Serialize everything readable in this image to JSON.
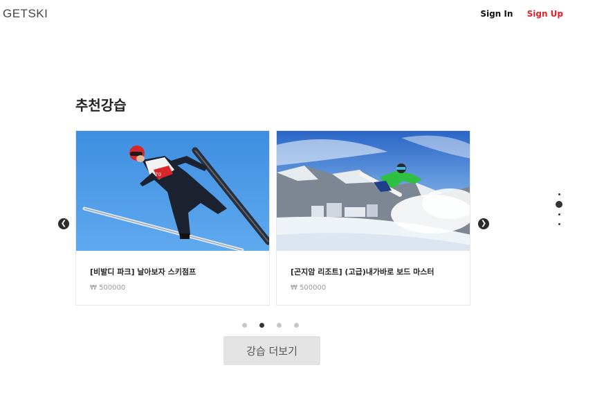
{
  "header": {
    "logo": "GETSKI",
    "sign_in": "Sign In",
    "sign_up": "Sign Up"
  },
  "section": {
    "title": "추천강습"
  },
  "cards": [
    {
      "title": "[비발디 파크] 날아보자 스키점프",
      "price": "₩ 500000",
      "image": "ski-jumper-photo"
    },
    {
      "title": "[곤지암 리조트] (고급)내가바로 보드 마스터",
      "price": "₩ 500000",
      "image": "snowboarder-photo"
    }
  ],
  "carousel": {
    "dot_count": 4,
    "active_dot": 1
  },
  "side_pager": {
    "dot_count": 4,
    "active_dot": 1
  },
  "more_button": "강습 더보기",
  "colors": {
    "accent": "#e8202a",
    "button_bg": "#e3e3e3",
    "arrow_bg": "#2b2b2b"
  }
}
